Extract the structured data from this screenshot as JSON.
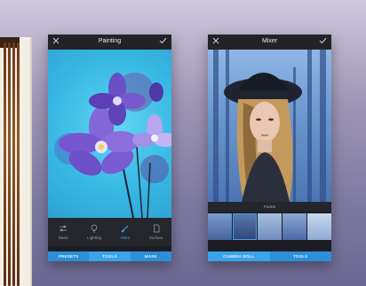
{
  "left_device": {},
  "painting_screen": {
    "title": "Painting",
    "tools": [
      {
        "label": "Basic",
        "icon": "sliders-icon",
        "active": false
      },
      {
        "label": "Lighting",
        "icon": "bulb-icon",
        "active": false
      },
      {
        "label": "Stem",
        "icon": "brush-icon",
        "active": true
      },
      {
        "label": "Surface",
        "icon": "document-icon",
        "active": false
      }
    ],
    "tabs": [
      {
        "label": "PRESETS",
        "active": false
      },
      {
        "label": "TOOLS",
        "active": true
      },
      {
        "label": "MASK",
        "active": false
      }
    ]
  },
  "mixer_screen": {
    "title": "Mixer",
    "strip_label": "Forest",
    "tabs": [
      {
        "label": "CAMERA ROLL",
        "active": true
      },
      {
        "label": "TOOLS",
        "active": false
      }
    ]
  },
  "colors": {
    "accent": "#3aa3ea",
    "tab_bar": "#2c8fd8",
    "toolbar": "#25262c",
    "titlebar": "#222328"
  }
}
